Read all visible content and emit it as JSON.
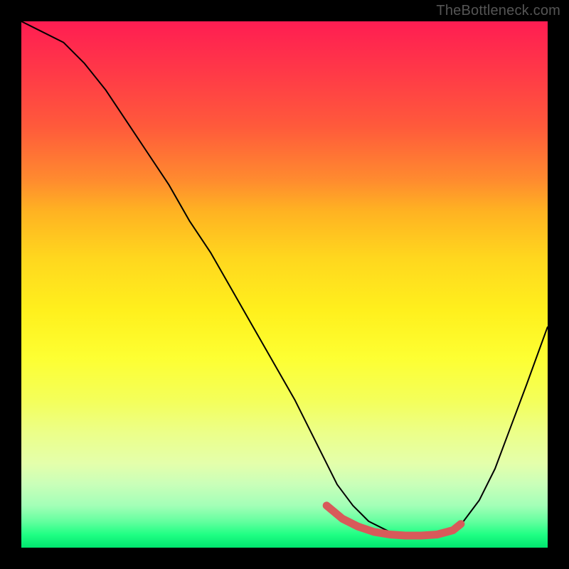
{
  "watermark": "TheBottleneck.com",
  "chart_data": {
    "type": "line",
    "title": "",
    "xlabel": "",
    "ylabel": "",
    "xlim": [
      0,
      100
    ],
    "ylim": [
      0,
      100
    ],
    "grid": false,
    "legend": false,
    "gradient_stops": [
      {
        "pos": 0,
        "color": "#ff1d52"
      },
      {
        "pos": 10,
        "color": "#ff3a47"
      },
      {
        "pos": 20,
        "color": "#ff5a3b"
      },
      {
        "pos": 30,
        "color": "#ff8a2f"
      },
      {
        "pos": 36,
        "color": "#ffb222"
      },
      {
        "pos": 45,
        "color": "#ffd71e"
      },
      {
        "pos": 55,
        "color": "#fff01d"
      },
      {
        "pos": 64,
        "color": "#fdff32"
      },
      {
        "pos": 72,
        "color": "#f4ff5a"
      },
      {
        "pos": 78,
        "color": "#ecff88"
      },
      {
        "pos": 84,
        "color": "#e4ffab"
      },
      {
        "pos": 88,
        "color": "#c9ffb9"
      },
      {
        "pos": 92,
        "color": "#a3ffb7"
      },
      {
        "pos": 95,
        "color": "#64ff9f"
      },
      {
        "pos": 97.5,
        "color": "#20ff84"
      },
      {
        "pos": 100,
        "color": "#00e56e"
      }
    ],
    "series": [
      {
        "name": "bottleneck-curve",
        "x": [
          0,
          4,
          8,
          12,
          16,
          20,
          24,
          28,
          32,
          36,
          40,
          44,
          48,
          52,
          55,
          58,
          60,
          63,
          66,
          70,
          74,
          78,
          82,
          84,
          87,
          90,
          93,
          96,
          100
        ],
        "y": [
          100,
          98,
          96,
          92,
          87,
          81,
          75,
          69,
          62,
          56,
          49,
          42,
          35,
          28,
          22,
          16,
          12,
          8,
          5,
          3,
          2,
          2,
          3,
          5,
          9,
          15,
          23,
          31,
          42
        ]
      }
    ],
    "annotations": {
      "start_marker": {
        "x": 58,
        "y": 8,
        "color": "#d85a5a",
        "radius": 5
      },
      "flat_segment": {
        "x": [
          58,
          61,
          64,
          67,
          70,
          73,
          76,
          79,
          82,
          83.5
        ],
        "y": [
          8,
          5.5,
          4,
          3,
          2.5,
          2.3,
          2.3,
          2.5,
          3.3,
          4.5
        ],
        "color": "#d85a5a",
        "stroke_width": 11
      }
    }
  }
}
